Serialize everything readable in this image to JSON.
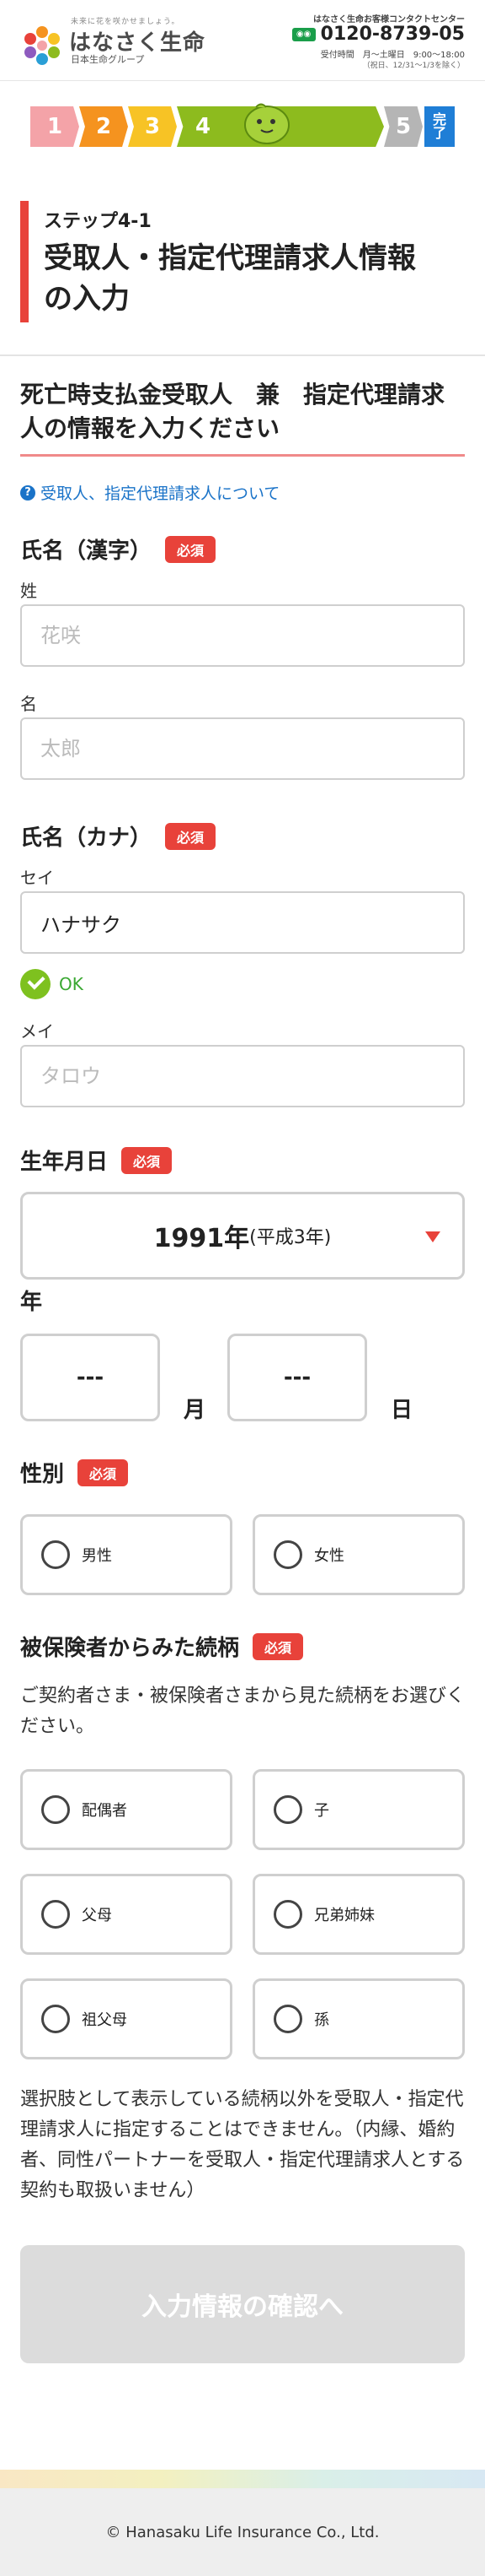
{
  "header": {
    "tagline": "未来に花を咲かせましょう。",
    "brand_name": "はなさく生命",
    "group_name": "日本生命グループ",
    "contact_title": "はなさく生命お客様コンタクトセンター",
    "free_dial_badge": "フリー",
    "phone": "0120-8739-05",
    "hours": "受付時間　月〜土曜日　9:00〜18:00",
    "hours_note": "（祝日、12/31〜1/3を除く）"
  },
  "steps": [
    {
      "label": "1",
      "color": "#f4a3a8"
    },
    {
      "label": "2",
      "color": "#f5931f"
    },
    {
      "label": "3",
      "color": "#f7c325"
    },
    {
      "label": "4",
      "color": "#8dbb1e"
    },
    {
      "label": "5",
      "color": "#b5b5b5"
    },
    {
      "label": "完了",
      "color": "#1f7ed6"
    }
  ],
  "title": {
    "step": "ステップ4-1",
    "main_line1": "受取人・指定代理請求人情報",
    "main_line2": "の入力"
  },
  "section": {
    "title_line1": "死亡時支払金受取人　兼　指定代理請求",
    "title_line2": "人の情報を入力ください"
  },
  "help_link": "受取人、指定代理請求人について",
  "required_badge": "必須",
  "name_kanji": {
    "label": "氏名（漢字）",
    "last_label": "姓",
    "last_placeholder": "花咲",
    "first_label": "名",
    "first_placeholder": "太郎"
  },
  "name_kana": {
    "label": "氏名（カナ）",
    "last_label": "セイ",
    "last_value": "ハナサク",
    "ok_text": "OK",
    "first_label": "メイ",
    "first_placeholder": "タロウ"
  },
  "birthdate": {
    "label": "生年月日",
    "year_value": "1991年",
    "year_era": "(平成3年)",
    "year_unit": "年",
    "month_value": "---",
    "month_unit": "月",
    "day_value": "---",
    "day_unit": "日"
  },
  "gender": {
    "label": "性別",
    "options": [
      "男性",
      "女性"
    ]
  },
  "relation": {
    "label": "被保険者からみた続柄",
    "description": "ご契約者さま・被保険者さまから見た続柄をお選びください。",
    "options": [
      "配偶者",
      "子",
      "父母",
      "兄弟姉妹",
      "祖父母",
      "孫"
    ]
  },
  "note": "選択肢として表示している続柄以外を受取人・指定代理請求人に指定することはできません。（内縁、婚約者、同性パートナーを受取人・指定代理請求人とする契約も取扱いません）",
  "confirm_button": "入力情報の確認へ",
  "footer": "© Hanasaku Life Insurance Co., Ltd."
}
